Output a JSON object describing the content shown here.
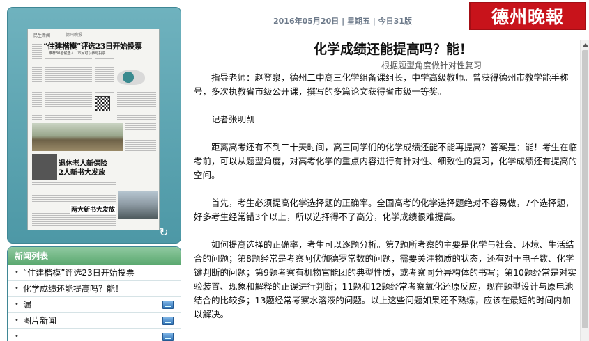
{
  "header": {
    "date": "2016年05月20日",
    "weekday": "星期五",
    "pages": "今日31版",
    "separator": "|",
    "logo": "德州晚報"
  },
  "thumbnail": {
    "section": "民生新闻",
    "masthead": "德州晚报",
    "headline1": "“住建楷模”评选23日开始投票",
    "subline1": "推荐30名候选人，市民可以参与投票",
    "headline2": "退休老人新保险",
    "headline3": "2人新书大发放",
    "headline4": "两大新书大发放"
  },
  "news_panel": {
    "title": "新闻列表",
    "items": [
      {
        "label": "“住建楷模”评选23日开始投票",
        "bullet": "•",
        "has_icon": false
      },
      {
        "label": "化学成绩还能提高吗？能！",
        "bullet": "•",
        "has_icon": false
      },
      {
        "label": "漏",
        "bullet": "•",
        "has_icon": true
      },
      {
        "label": "图片新闻",
        "bullet": "•",
        "has_icon": true
      },
      {
        "label": "",
        "bullet": "•",
        "has_icon": true
      }
    ]
  },
  "article": {
    "title": "化学成绩还能提高吗？能！",
    "subtitle": "根据题型角度做针对性复习",
    "paragraphs": [
      "指导老师：赵登泉，德州二中高三化学组备课组长，中学高级教师。曾获得德州市教学能手称号，多次执教省市级公开课，撰写的多篇论文获得省市级一等奖。",
      "记者张明凯",
      "距离高考还有不到二十天时间，高三同学们的化学成绩还能不能再提高？答案是：能！考生在临考前，可以从题型角度，对高考化学的重点内容进行有针对性、细致性的复习，化学成绩还有提高的空间。",
      "首先，考生必须提高化学选择题的正确率。全国高考的化学选择题绝对不容易做，7个选择题，好多考生经常错3个以上，所以选择得不了高分，化学成绩很难提高。",
      "如何提高选择的正确率，考生可以逐题分析。第7题所考察的主要是化学与社会、环境、生活结合的问题；第8题经常是考察阿伏伽德罗常数的问题，需要关注物质的状态，还有对于电子数、化学键判断的问题；第9题考察有机物官能团的典型性质，或考察同分异构体的书写；第10题经常是对实验装置、现象和解释的正误进行判断；11题和12题经常考察氧化还原反应，现在题型设计与原电池结合的比较多；13题经常考察水溶液的问题。以上这些问题如果还不熟练，应该在最短的时间内加以解决。"
    ]
  },
  "colors": {
    "panel_teal": "#4d98a6",
    "news_header_green": "#5aa86f",
    "logo_red": "#c8131b",
    "date_gray": "#6d7a8a"
  },
  "icons": {
    "refresh": "refresh-icon",
    "media": "media-icon"
  }
}
